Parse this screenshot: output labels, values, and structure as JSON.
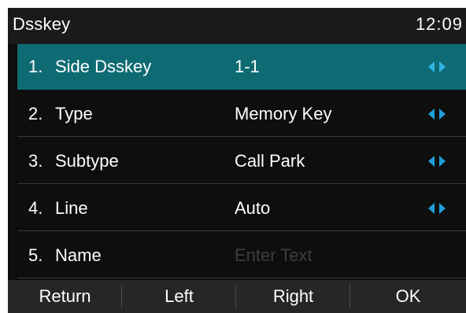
{
  "header": {
    "title": "Dsskey",
    "clock": "12:09"
  },
  "rows": [
    {
      "num": "1.",
      "label": "Side Dsskey",
      "value": "1-1",
      "arrows": true,
      "selected": true
    },
    {
      "num": "2.",
      "label": "Type",
      "value": "Memory Key",
      "arrows": true
    },
    {
      "num": "3.",
      "label": "Subtype",
      "value": "Call Park",
      "arrows": true
    },
    {
      "num": "4.",
      "label": "Line",
      "value": "Auto",
      "arrows": true
    },
    {
      "num": "5.",
      "label": "Name",
      "placeholder": "Enter Text",
      "value": ""
    }
  ],
  "softkeys": [
    "Return",
    "Left",
    "Right",
    "OK"
  ],
  "colors": {
    "accent": "#0e6b73",
    "arrow": "#1e9fd8",
    "background": "#0e0e0e"
  },
  "icons": {
    "left": "arrow-left-icon",
    "right": "arrow-right-icon"
  }
}
